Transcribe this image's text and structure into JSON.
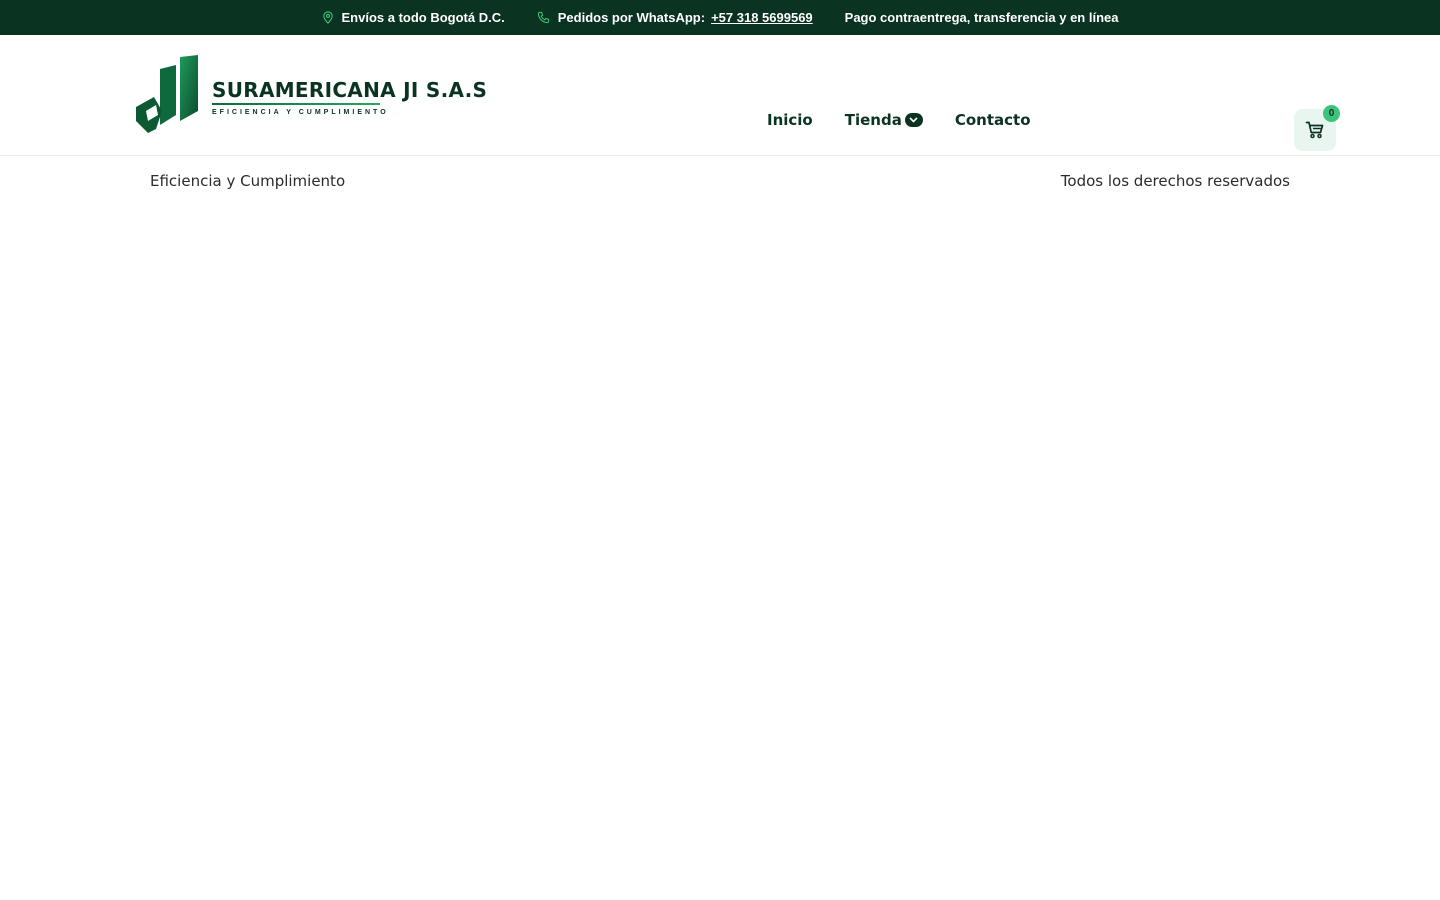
{
  "topbar": {
    "shipping_text": "Envíos a todo Bogotá D.C.",
    "whatsapp_label": "Pedidos por WhatsApp:",
    "whatsapp_number": "+57 318 5699569",
    "payment_text": "Pago contraentrega, transferencia y en línea"
  },
  "brand": {
    "name": "SURAMERICANA JI  S.A.S",
    "tagline": "EFICIENCIA Y CUMPLIMIENTO"
  },
  "nav": {
    "items": [
      {
        "label": "Inicio"
      },
      {
        "label": "Tienda"
      },
      {
        "label": "Contacto"
      }
    ]
  },
  "cart": {
    "count": "0"
  },
  "footer": {
    "left_text": "Eficiencia y Cumplimiento",
    "right_text": "Todos los derechos reservados"
  },
  "colors": {
    "topbar_bg": "#0b3321",
    "brand_green": "#0b6b3e",
    "accent_green": "#3cc47d"
  },
  "icons": {
    "shipping": "location-pin-icon",
    "whatsapp": "phone-icon",
    "dropdown": "chevron-down-icon",
    "cart": "shopping-cart-icon"
  }
}
